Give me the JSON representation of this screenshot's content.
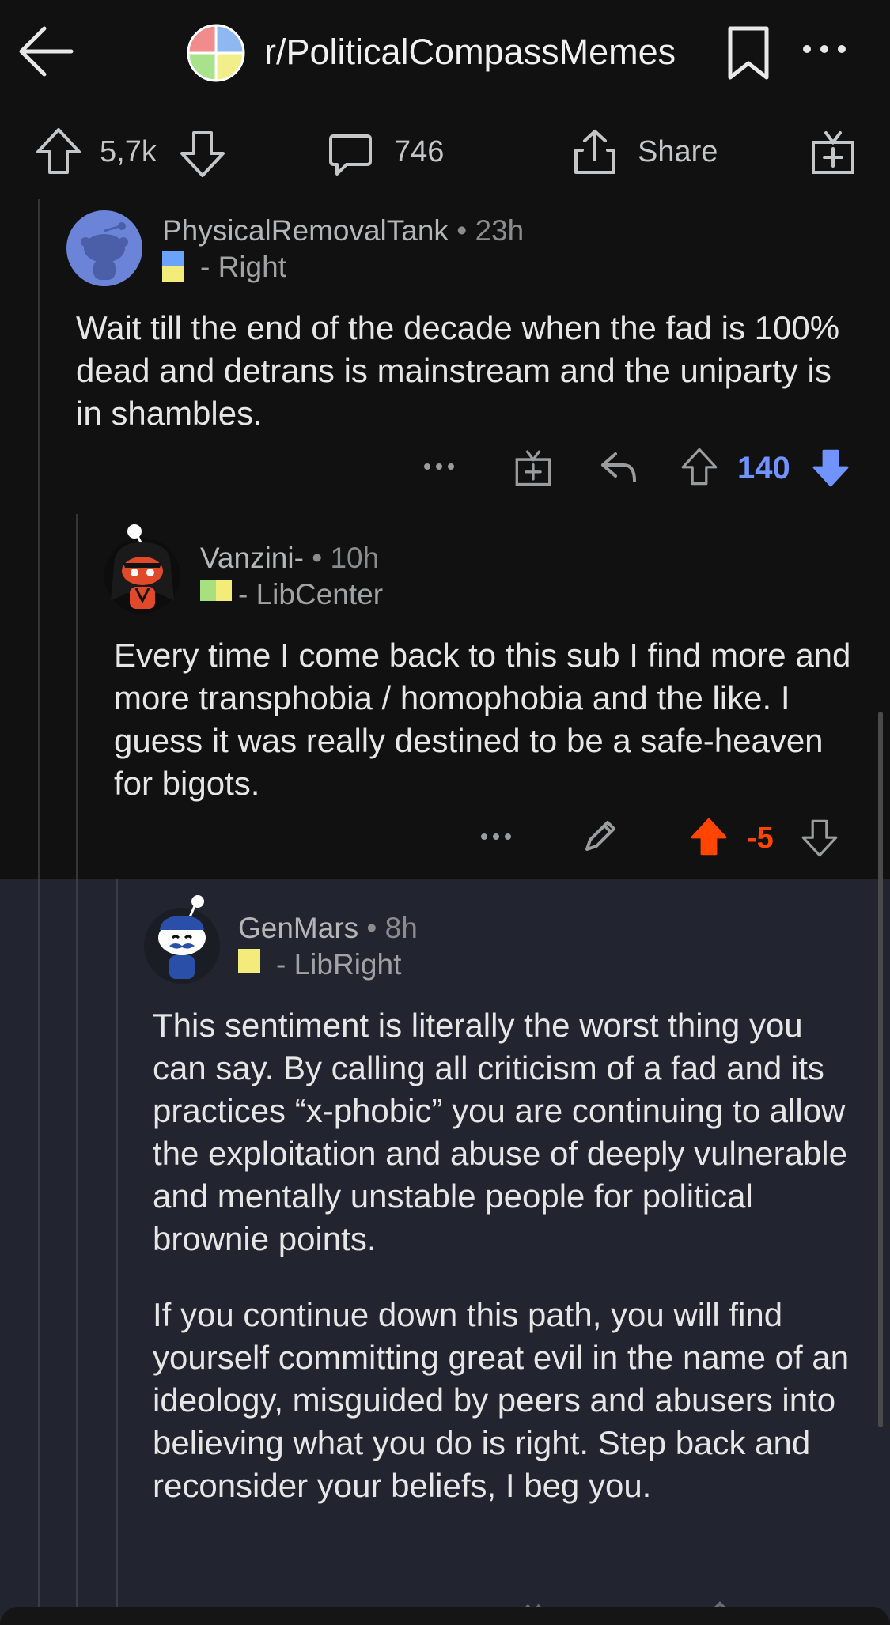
{
  "header": {
    "subreddit": "r/PoliticalCompassMemes"
  },
  "post_stats": {
    "upvotes": "5,7k",
    "comments": "746",
    "share_label": "Share"
  },
  "comments": [
    {
      "username": "PhysicalRemovalTank",
      "time": "23h",
      "flair": "- Right",
      "body": [
        "Wait till the end of the decade when the fad is 100% dead and detrans is mainstream and the uniparty is in shambles."
      ],
      "score": "140",
      "vote_state": "downvoted"
    },
    {
      "username": "Vanzini-",
      "time": "10h",
      "flair": "- LibCenter",
      "body": [
        "Every time I come back to this sub I find more and more transphobia  / homophobia and the like. I guess it was really destined to be a safe-heaven for bigots."
      ],
      "score": "-5",
      "vote_state": "upvoted"
    },
    {
      "username": "GenMars",
      "time": "8h",
      "flair": "- LibRight",
      "body": [
        "This sentiment is literally the worst thing you can say. By calling all criticism of a fad and its practices “x-phobic” you are continuing to allow the exploitation and abuse of deeply vulnerable and mentally unstable people for political brownie points.",
        "If you continue down this path, you will find yourself committing great evil in the name of an ideology, misguided by peers and abusers into believing what you do is right. Step back and reconsider your beliefs, I beg you."
      ]
    }
  ],
  "colors": {
    "background": "#111111",
    "highlight": "#22252f",
    "upvote": "#ff4500",
    "downvote": "#7193ff",
    "text": "#e6e6e6"
  },
  "icons": [
    "back-arrow-icon",
    "subreddit-icon",
    "bookmark-icon",
    "more-icon",
    "upvote-icon",
    "downvote-icon",
    "comment-icon",
    "share-icon",
    "award-icon",
    "reply-icon",
    "edit-icon"
  ]
}
